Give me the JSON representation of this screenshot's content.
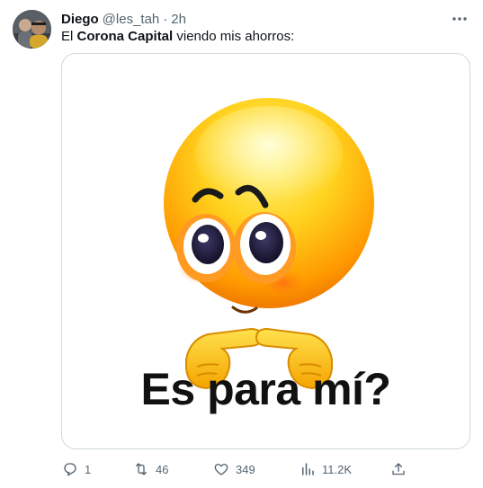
{
  "author": {
    "name": "Diego",
    "handle": "@les_tah",
    "separator": "·",
    "time": "2h"
  },
  "tweet": {
    "text_before": "El ",
    "text_bold": "Corona Capital",
    "text_after": " viendo mis ahorros:"
  },
  "media": {
    "caption": "Es para mí?",
    "subject": "smiling-emoji-pointing-fingers"
  },
  "actions": {
    "reply_count": "1",
    "retweet_count": "46",
    "like_count": "349",
    "views_count": "11.2K"
  },
  "colors": {
    "text": "#0f1419",
    "muted": "#536471",
    "border": "#cfd9de",
    "emoji_yellow": "#ffd21e",
    "emoji_orange": "#ff8a00"
  }
}
